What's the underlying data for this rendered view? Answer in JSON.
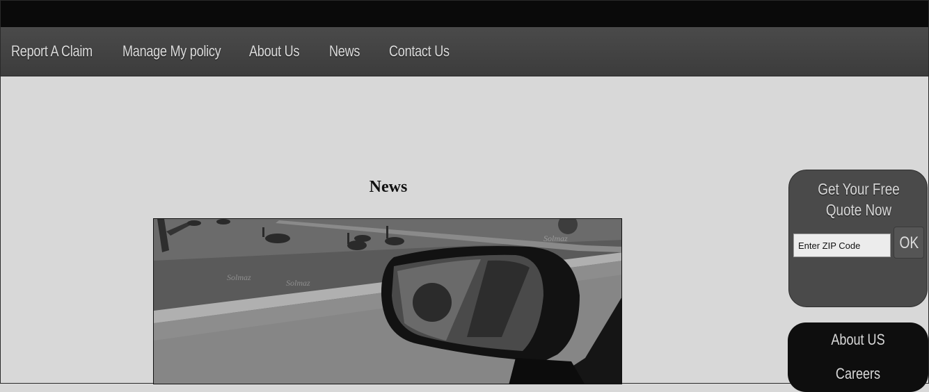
{
  "nav": {
    "items": [
      {
        "label": "Report A Claim"
      },
      {
        "label": "Manage My policy"
      },
      {
        "label": "About Us"
      },
      {
        "label": "News"
      },
      {
        "label": "Contact Us"
      }
    ]
  },
  "main": {
    "title": "News",
    "image_watermark": "Solmaz"
  },
  "quote": {
    "title": "Get Your Free Quote Now",
    "zip_placeholder": "Enter ZIP Code",
    "ok_label": "OK"
  },
  "side_links": {
    "items": [
      {
        "label": "About US"
      },
      {
        "label": "Careers"
      }
    ]
  }
}
